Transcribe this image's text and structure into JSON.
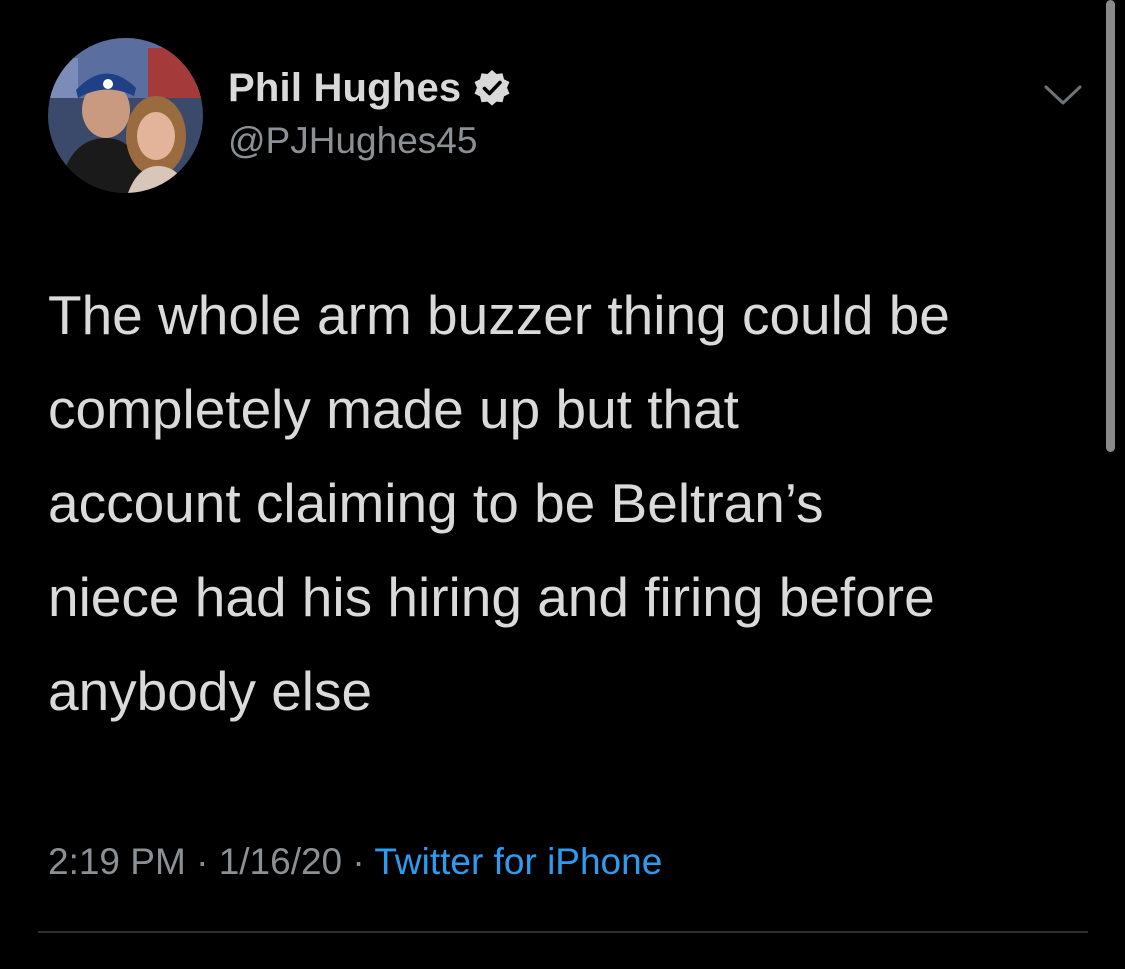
{
  "tweet": {
    "author": {
      "display_name": "Phil Hughes",
      "handle": "@PJHughes45",
      "verified": true,
      "avatar_icon": "profile-photo"
    },
    "text": "The whole arm buzzer thing could be\ncompletely made up but that\naccount claiming to be Beltran’s\nniece had his hiring and firing before\nanybody else",
    "meta": {
      "time": "2:19 PM",
      "separator": "·",
      "date": "1/16/20",
      "source": "Twitter for iPhone"
    },
    "menu_icon": "chevron-down-icon"
  },
  "colors": {
    "background": "#000000",
    "primary_text": "#dadada",
    "secondary_text": "#8b9095",
    "link": "#2d9cf0",
    "verified_badge": "#d9d9d9"
  }
}
